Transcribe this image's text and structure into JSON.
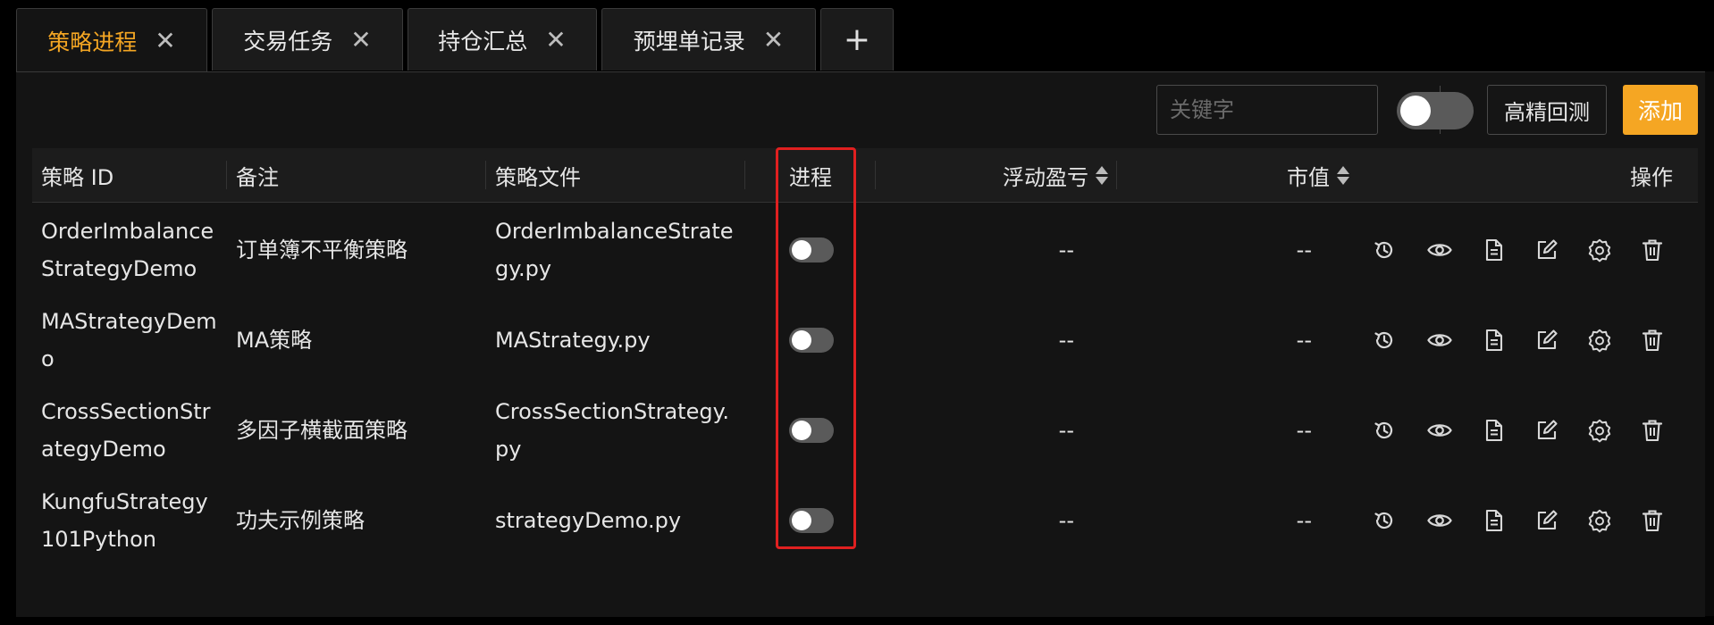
{
  "tabs": [
    {
      "label": "策略进程",
      "active": true
    },
    {
      "label": "交易任务",
      "active": false
    },
    {
      "label": "持仓汇总",
      "active": false
    },
    {
      "label": "预埋单记录",
      "active": false
    }
  ],
  "tab_add_label": "+",
  "toolbar": {
    "search_placeholder": "关键字",
    "hp_backtest_label": "高精回测",
    "add_label": "添加"
  },
  "table": {
    "columns": {
      "id": "策略 ID",
      "note": "备注",
      "file": "策略文件",
      "process": "进程",
      "pnl": "浮动盈亏",
      "market_value": "市值",
      "actions": "操作"
    },
    "rows": [
      {
        "id": "OrderImbalanceStrategyDemo",
        "note": "订单簿不平衡策略",
        "file": "OrderImbalanceStrategy.py",
        "process_on": false,
        "pnl": "--",
        "market_value": "--"
      },
      {
        "id": "MAStrategyDemo",
        "note": "MA策略",
        "file": "MAStrategy.py",
        "process_on": false,
        "pnl": "--",
        "market_value": "--"
      },
      {
        "id": "CrossSectionStrategyDemo",
        "note": "多因子横截面策略",
        "file": "CrossSectionStrategy.py",
        "process_on": false,
        "pnl": "--",
        "market_value": "--"
      },
      {
        "id": "KungfuStrategy101Python",
        "note": "功夫示例策略",
        "file": "strategyDemo.py",
        "process_on": false,
        "pnl": "--",
        "market_value": "--"
      }
    ],
    "row_action_icons": [
      "history-icon",
      "eye-icon",
      "file-icon",
      "edit-icon",
      "settings-icon",
      "trash-icon"
    ]
  },
  "colors": {
    "accent": "#f5a623",
    "highlight": "#e02020",
    "background": "#141414"
  }
}
